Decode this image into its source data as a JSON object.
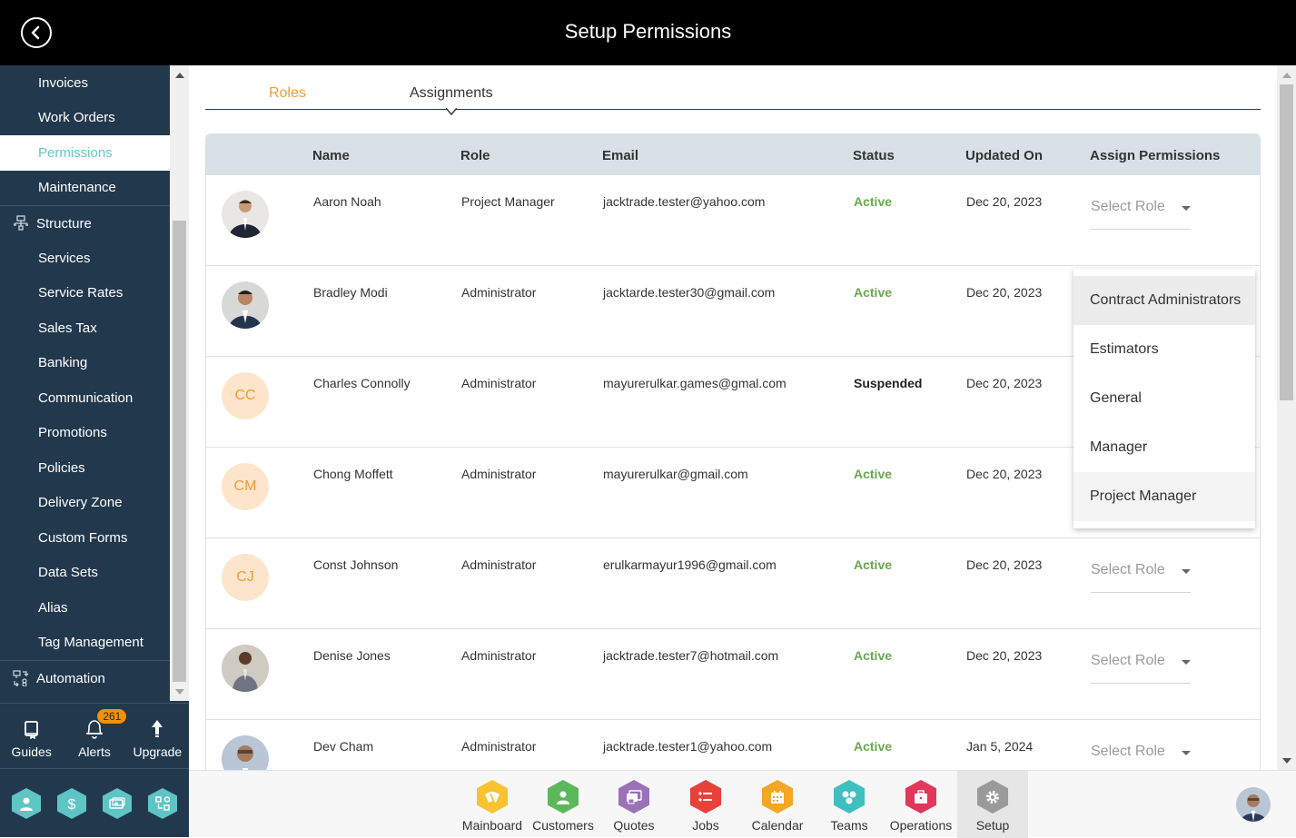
{
  "header": {
    "title": "Setup Permissions",
    "back_icon": "chevron-left-circle-icon"
  },
  "sidebar": {
    "items": [
      {
        "label": "Invoices",
        "type": "item"
      },
      {
        "label": "Work Orders",
        "type": "item"
      },
      {
        "label": "Permissions",
        "type": "item",
        "active": true
      },
      {
        "label": "Maintenance",
        "type": "item"
      },
      {
        "label": "Structure",
        "type": "group",
        "icon": "sitemap-icon"
      },
      {
        "label": "Services",
        "type": "item"
      },
      {
        "label": "Service Rates",
        "type": "item"
      },
      {
        "label": "Sales Tax",
        "type": "item"
      },
      {
        "label": "Banking",
        "type": "item"
      },
      {
        "label": "Communication",
        "type": "item"
      },
      {
        "label": "Promotions",
        "type": "item"
      },
      {
        "label": "Policies",
        "type": "item"
      },
      {
        "label": "Delivery Zone",
        "type": "item"
      },
      {
        "label": "Custom Forms",
        "type": "item"
      },
      {
        "label": "Data Sets",
        "type": "item"
      },
      {
        "label": "Alias",
        "type": "item"
      },
      {
        "label": "Tag Management",
        "type": "item"
      },
      {
        "label": "Automation",
        "type": "group",
        "icon": "automation-icon"
      }
    ],
    "tools": [
      {
        "label": "Guides",
        "icon": "book-icon"
      },
      {
        "label": "Alerts",
        "icon": "bell-icon",
        "badge": "261"
      },
      {
        "label": "Upgrade",
        "icon": "arrow-up-icon"
      }
    ],
    "apps": [
      {
        "icon": "user-icon"
      },
      {
        "icon": "dollar-icon"
      },
      {
        "icon": "money-icon"
      },
      {
        "icon": "workflow-icon"
      }
    ]
  },
  "tabs": [
    {
      "label": "Roles",
      "active": false
    },
    {
      "label": "Assignments",
      "active": true
    }
  ],
  "table": {
    "columns": [
      "Name",
      "Role",
      "Email",
      "Status",
      "Updated On",
      "Assign Permissions"
    ],
    "rows": [
      {
        "avatar": "photo",
        "initials": "",
        "name": "Aaron Noah",
        "role": "Project Manager",
        "email": "jacktrade.tester@yahoo.com",
        "status": "Active",
        "updated": "Dec 20, 2023",
        "select": "Select Role"
      },
      {
        "avatar": "photo",
        "initials": "",
        "name": "Bradley Modi",
        "role": "Administrator",
        "email": "jacktarde.tester30@gmail.com",
        "status": "Active",
        "updated": "Dec 20, 2023",
        "select": ""
      },
      {
        "avatar": "initials",
        "initials": "CC",
        "name": "Charles Connolly",
        "role": "Administrator",
        "email": "mayurerulkar.games@gmal.com",
        "status": "Suspended",
        "updated": "Dec 20, 2023",
        "select": ""
      },
      {
        "avatar": "initials",
        "initials": "CM",
        "name": "Chong Moffett",
        "role": "Administrator",
        "email": "mayurerulkar@gmail.com",
        "status": "Active",
        "updated": "Dec 20, 2023",
        "select": ""
      },
      {
        "avatar": "initials",
        "initials": "CJ",
        "name": "Const Johnson",
        "role": "Administrator",
        "email": "erulkarmayur1996@gmail.com",
        "status": "Active",
        "updated": "Dec 20, 2023",
        "select": "Select Role"
      },
      {
        "avatar": "photo",
        "initials": "",
        "name": "Denise Jones",
        "role": "Administrator",
        "email": "jacktrade.tester7@hotmail.com",
        "status": "Active",
        "updated": "Dec 20, 2023",
        "select": "Select Role"
      },
      {
        "avatar": "photo",
        "initials": "",
        "name": "Dev Cham",
        "role": "Administrator",
        "email": "jacktrade.tester1@yahoo.com",
        "status": "Active",
        "updated": "Jan 5, 2024",
        "select": "Select Role"
      }
    ]
  },
  "role_dropdown": {
    "options": [
      "Contract Administrators",
      "Estimators",
      "General",
      "Manager",
      "Project Manager"
    ],
    "highlighted": "Contract Administrators"
  },
  "bottom_nav": [
    {
      "label": "Mainboard",
      "color": "#f8c230",
      "icon": "dashboard-icon"
    },
    {
      "label": "Customers",
      "color": "#5cb85c",
      "icon": "user-icon"
    },
    {
      "label": "Quotes",
      "color": "#9b72b8",
      "icon": "quotes-icon"
    },
    {
      "label": "Jobs",
      "color": "#e8413a",
      "icon": "list-icon"
    },
    {
      "label": "Calendar",
      "color": "#f5a623",
      "icon": "calendar-icon"
    },
    {
      "label": "Teams",
      "color": "#3fbfbf",
      "icon": "team-icon"
    },
    {
      "label": "Operations",
      "color": "#e0375a",
      "icon": "briefcase-icon"
    },
    {
      "label": "Setup",
      "color": "#9a9a9a",
      "icon": "gear-icon",
      "active": true
    }
  ],
  "colors": {
    "accent_orange": "#f39c36",
    "accent_teal": "#6cc3c7",
    "sidebar_bg": "#22384d",
    "active_green": "#68a94f"
  }
}
